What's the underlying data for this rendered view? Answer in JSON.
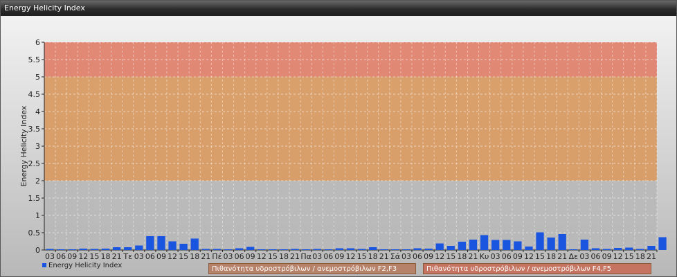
{
  "window": {
    "title": "Energy Helicity Index"
  },
  "chart_data": {
    "type": "bar",
    "ylabel": "Energy Helicity Index",
    "ylim": [
      0,
      6
    ],
    "yticks": [
      "0",
      "0.5",
      "1",
      "1.5",
      "2",
      "2.5",
      "3",
      "3.5",
      "4",
      "4.5",
      "5",
      "5.5",
      "6"
    ],
    "bands": [
      {
        "from": 0,
        "to": 2,
        "color": "#b9b9b9"
      },
      {
        "from": 2,
        "to": 5,
        "color": "#d99a62"
      },
      {
        "from": 5,
        "to": 6,
        "color": "#e0806a"
      }
    ],
    "categories": [
      "03",
      "06",
      "09",
      "12",
      "15",
      "18",
      "21",
      "Τε",
      "03",
      "06",
      "09",
      "12",
      "15",
      "18",
      "21",
      "Πέ",
      "03",
      "06",
      "09",
      "12",
      "15",
      "18",
      "21",
      "Πα",
      "03",
      "06",
      "09",
      "12",
      "15",
      "18",
      "21",
      "Σά",
      "03",
      "06",
      "09",
      "12",
      "15",
      "18",
      "21",
      "Κυ",
      "03",
      "06",
      "09",
      "12",
      "15",
      "18",
      "21",
      "Δε",
      "03",
      "06",
      "09",
      "12",
      "15",
      "18",
      "21"
    ],
    "series": [
      {
        "name": "Energy Helicity Index",
        "color": "#1a55e0",
        "values": [
          0.03,
          0.02,
          0.02,
          0.04,
          0.03,
          0.04,
          0.08,
          0.08,
          0.13,
          0.4,
          0.4,
          0.25,
          0.18,
          0.33,
          0.03,
          0.03,
          0.02,
          0.05,
          0.09,
          0.02,
          0.02,
          0.02,
          0.03,
          0.02,
          0.03,
          0.02,
          0.05,
          0.05,
          0.03,
          0.08,
          0.02,
          0.02,
          0.02,
          0.05,
          0.04,
          0.19,
          0.12,
          0.24,
          0.3,
          0.43,
          0.29,
          0.29,
          0.25,
          0.1,
          0.51,
          0.36,
          0.46,
          0.02,
          0.3,
          0.05,
          0.03,
          0.06,
          0.07,
          0.03,
          0.12,
          0.37
        ]
      }
    ],
    "legend_note_1": "Πιθανότητα υδροστρόβιλων / ανεμοστρόβιλων F2,F3",
    "legend_note_2": "Πιθανότητα υδροστρόβιλων / ανεμοστρόβιλων F4,F5",
    "legend_note_1_color": "#b7826a",
    "legend_note_2_color": "#c57462"
  }
}
